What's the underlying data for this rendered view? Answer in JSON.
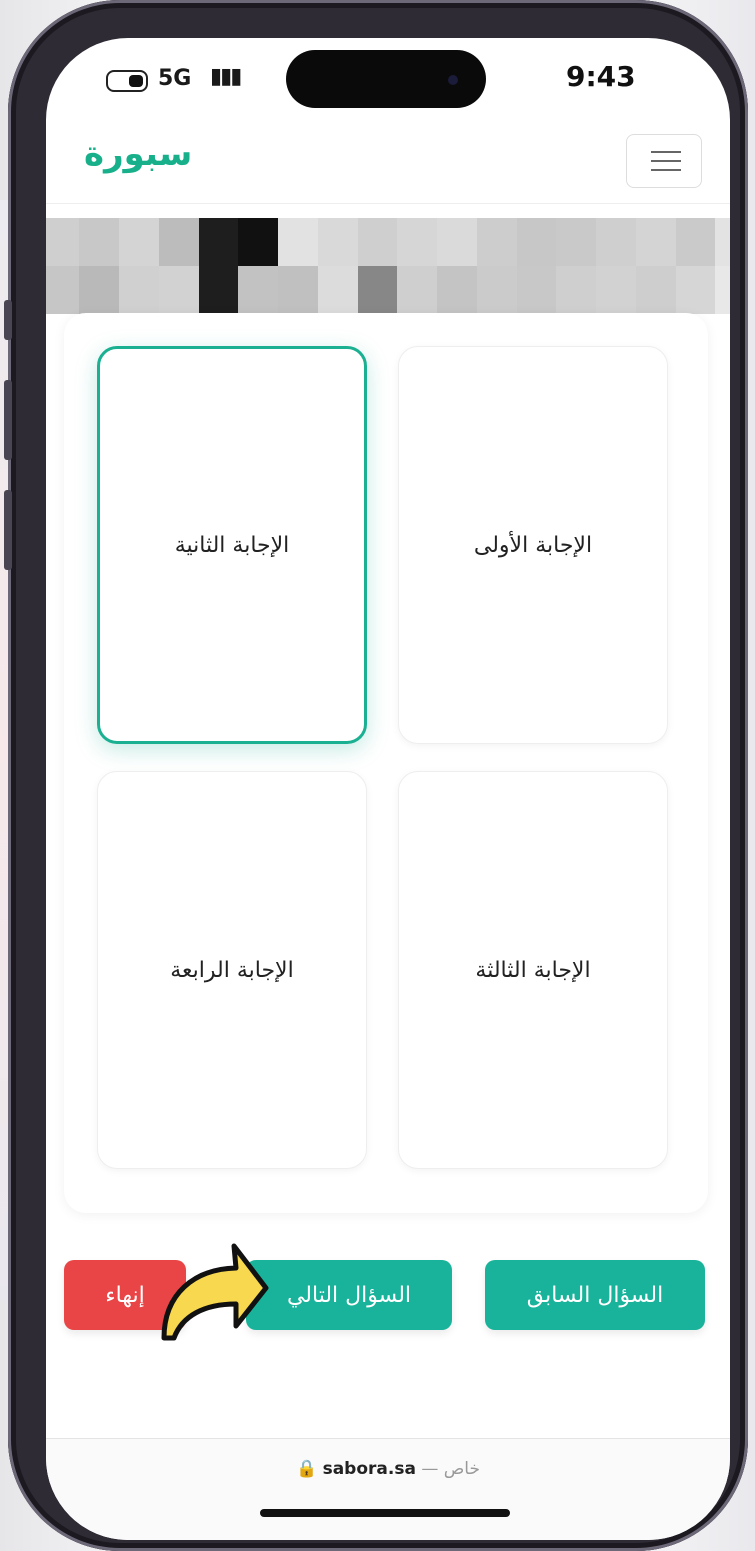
{
  "status_bar": {
    "network": "5G",
    "time": "9:43"
  },
  "header": {
    "logo": "سبورة",
    "menu_icon": "hamburger-menu-icon"
  },
  "answers": [
    {
      "label": "الإجابة الأولى",
      "selected": false
    },
    {
      "label": "الإجابة الثانية",
      "selected": true
    },
    {
      "label": "الإجابة الثالثة",
      "selected": false
    },
    {
      "label": "الإجابة الرابعة",
      "selected": false
    }
  ],
  "navigation": {
    "previous_label": "السؤال السابق",
    "next_label": "السؤال التالي",
    "end_label": "إنهاء"
  },
  "browser": {
    "domain": "sabora.sa",
    "privacy": "خاص",
    "separator": "—"
  },
  "colors": {
    "accent": "#18b39a",
    "danger": "#e94446",
    "annotation_arrow": "#f7d84e"
  }
}
